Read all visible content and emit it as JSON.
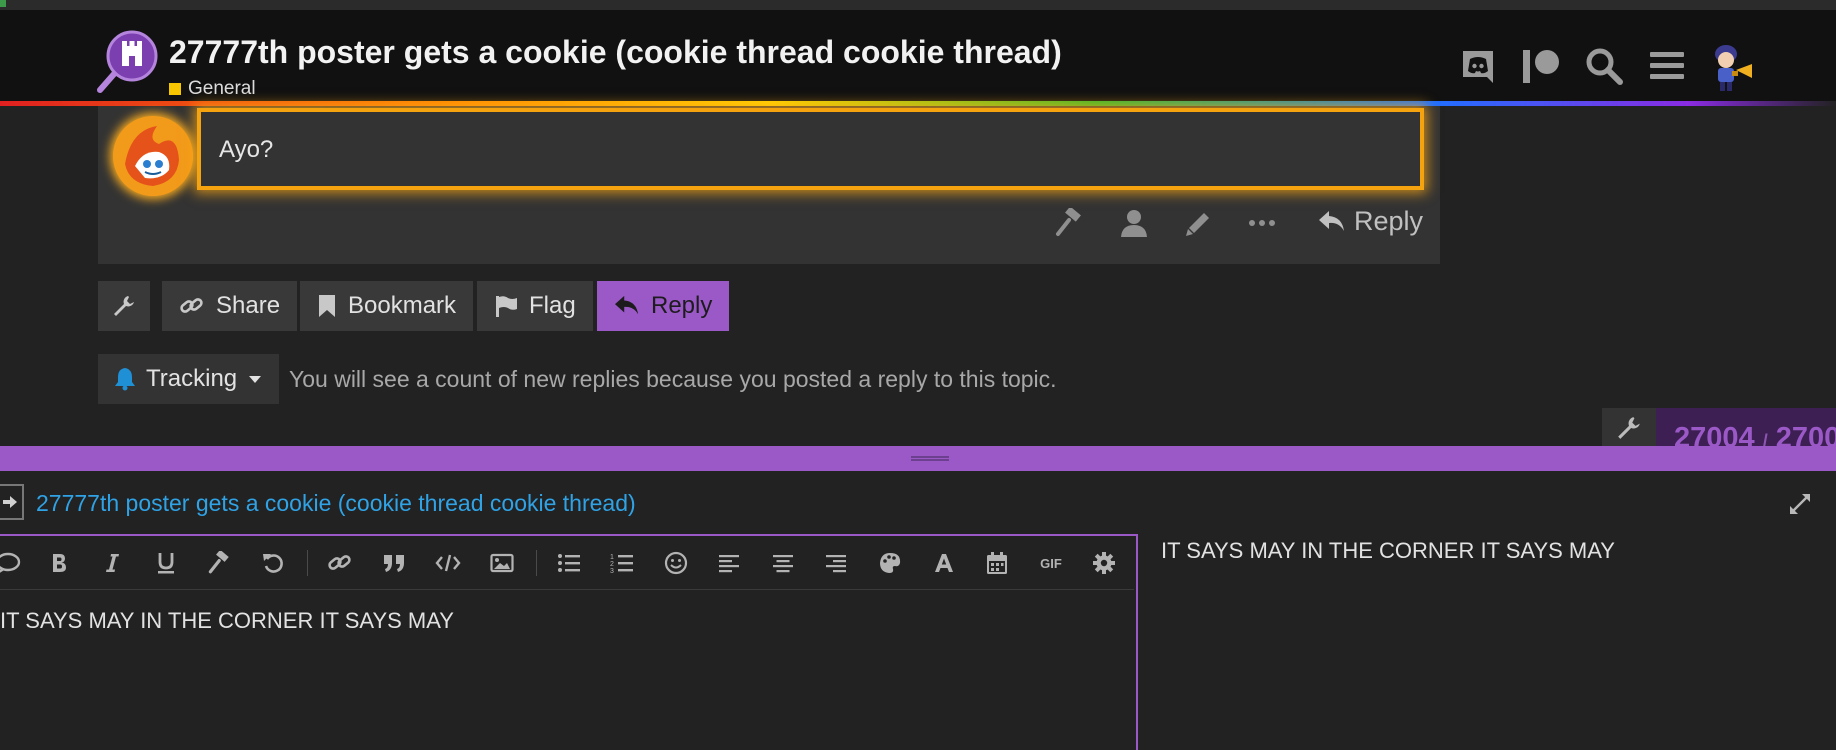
{
  "header": {
    "topic_title": "27777th poster gets a cookie (cookie thread cookie thread)",
    "category": "General",
    "category_color": "#f7c600",
    "icons": [
      "discord-icon",
      "patreon-icon",
      "search-icon",
      "hamburger-menu-icon",
      "user-avatar"
    ]
  },
  "post": {
    "body": "Ayo?",
    "actions": [
      "gavel-icon",
      "user-icon",
      "pencil-icon",
      "ellipsis-icon"
    ],
    "reply_label": "Reply"
  },
  "topic_footer": {
    "share": "Share",
    "bookmark": "Bookmark",
    "flag": "Flag",
    "reply": "Reply"
  },
  "tracking": {
    "label": "Tracking",
    "reason": "You will see a count of new replies because you posted a reply to this topic."
  },
  "timeline": {
    "current": "27004",
    "separator": "/",
    "total": "2700"
  },
  "composer": {
    "title": "27777th poster gets a cookie (cookie thread cookie thread)",
    "editor_text": "IT SAYS MAY IN THE CORNER IT SAYS MAY",
    "preview_text": "IT SAYS MAY IN THE CORNER IT SAYS MAY",
    "toolbar_gif": "GIF"
  },
  "colors": {
    "accent": "#9b59c7",
    "link": "#2fa3e6",
    "highlight": "#f5a410",
    "background": "#222222"
  }
}
